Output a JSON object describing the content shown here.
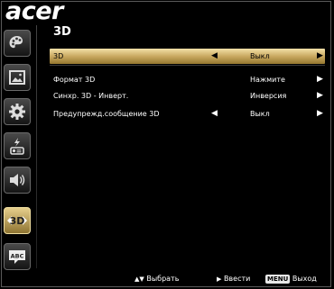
{
  "brand": "acer",
  "sidebar": {
    "items": [
      {
        "icon": "palette-icon"
      },
      {
        "icon": "picture-icon"
      },
      {
        "icon": "gear-icon"
      },
      {
        "icon": "power-management-icon"
      },
      {
        "icon": "audio-icon"
      },
      {
        "icon": "3d-icon",
        "label": "3D",
        "active": true
      },
      {
        "icon": "language-icon",
        "label": "ABC"
      }
    ]
  },
  "panel": {
    "title": "3D",
    "rows": [
      {
        "label": "3D",
        "value": "Выкл",
        "has_left_arrow": true,
        "selected": true
      },
      {
        "label": "Формат 3D",
        "value": "Нажмите",
        "has_left_arrow": false
      },
      {
        "label": "Синхр. 3D - Инверт.",
        "value": "Инверсия",
        "has_left_arrow": false
      },
      {
        "label": "Предупрежд.сообщение 3D",
        "value": "Выкл",
        "has_left_arrow": true
      }
    ]
  },
  "footer": {
    "select_label": "Выбрать",
    "enter_label": "Ввести",
    "menu_key": "MENU",
    "exit_label": "Выход"
  },
  "colors": {
    "highlight_top": "#f3e1a8",
    "highlight_bottom": "#96782f",
    "background": "#000000"
  }
}
